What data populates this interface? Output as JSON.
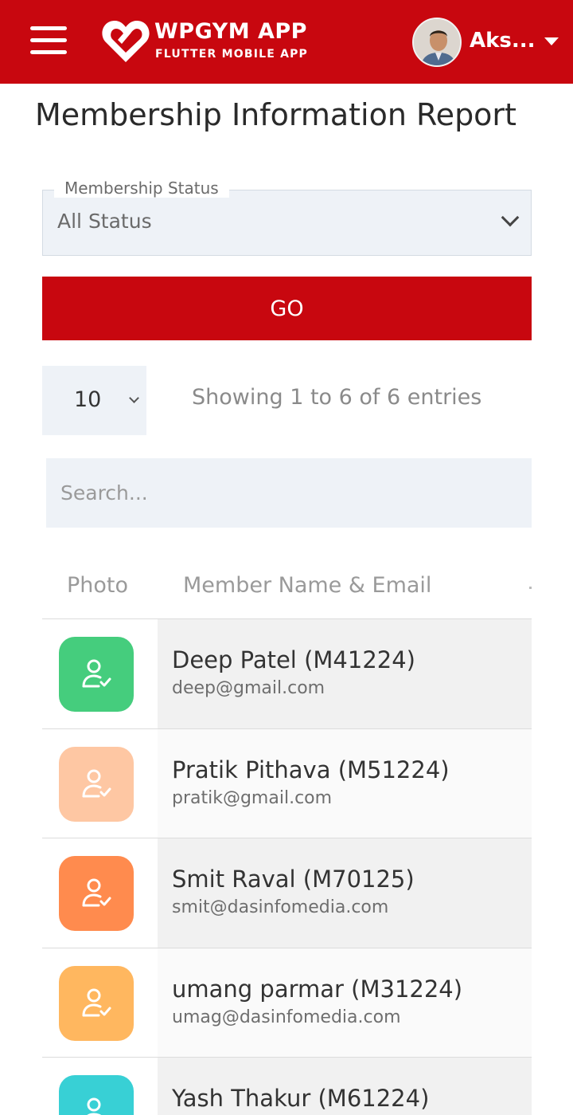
{
  "header": {
    "app_title": "WPGYM APP",
    "app_subtitle": "FLUTTER MOBILE APP",
    "user_name": "Aks...",
    "brand_color": "#c8070f"
  },
  "page": {
    "title": "Membership Information Report"
  },
  "filter": {
    "status_label": "Membership Status",
    "status_value": "All Status",
    "go_label": "GO"
  },
  "listing": {
    "page_size": "10",
    "entries_info": "Showing 1 to 6 of 6 entries",
    "search_placeholder": "Search..."
  },
  "table": {
    "columns": [
      "Photo",
      "Member Name & Email"
    ],
    "rows": [
      {
        "name": "Deep Patel (M41224)",
        "email": "deep@gmail.com",
        "avatar_color": "#45cd7d",
        "icon": "user-check-icon"
      },
      {
        "name": "Pratik Pithava (M51224)",
        "email": "pratik@gmail.com",
        "avatar_color": "#fec7a3",
        "icon": "user-check-icon"
      },
      {
        "name": "Smit Raval (M70125)",
        "email": "smit@dasinfomedia.com",
        "avatar_color": "#ff8b4e",
        "icon": "user-check-icon"
      },
      {
        "name": "umang parmar (M31224)",
        "email": "umag@dasinfomedia.com",
        "avatar_color": "#ffb75f",
        "icon": "user-check-icon"
      },
      {
        "name": "Yash Thakur (M61224)",
        "email": "",
        "avatar_color": "#38d0d5",
        "icon": "user-check-icon"
      }
    ]
  }
}
